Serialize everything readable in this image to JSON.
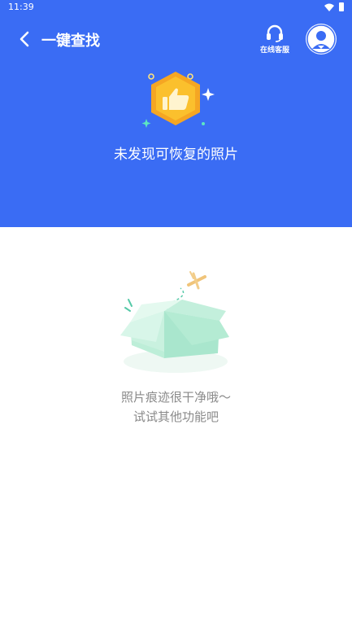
{
  "status_bar": {
    "time": "11:39"
  },
  "nav": {
    "title": "一键查找",
    "service_label": "在线客服"
  },
  "hero": {
    "text": "未发现可恢复的照片"
  },
  "empty_state": {
    "line1": "照片痕迹很干净哦～",
    "line2": "试试其他功能吧"
  },
  "colors": {
    "header_blue": "#3a6cf4",
    "badge_gold": "#f5a623",
    "box_green": "#b8ecd6"
  },
  "icons": [
    "back-arrow",
    "headset",
    "avatar",
    "thumbs-up-badge",
    "open-box",
    "airplane"
  ]
}
